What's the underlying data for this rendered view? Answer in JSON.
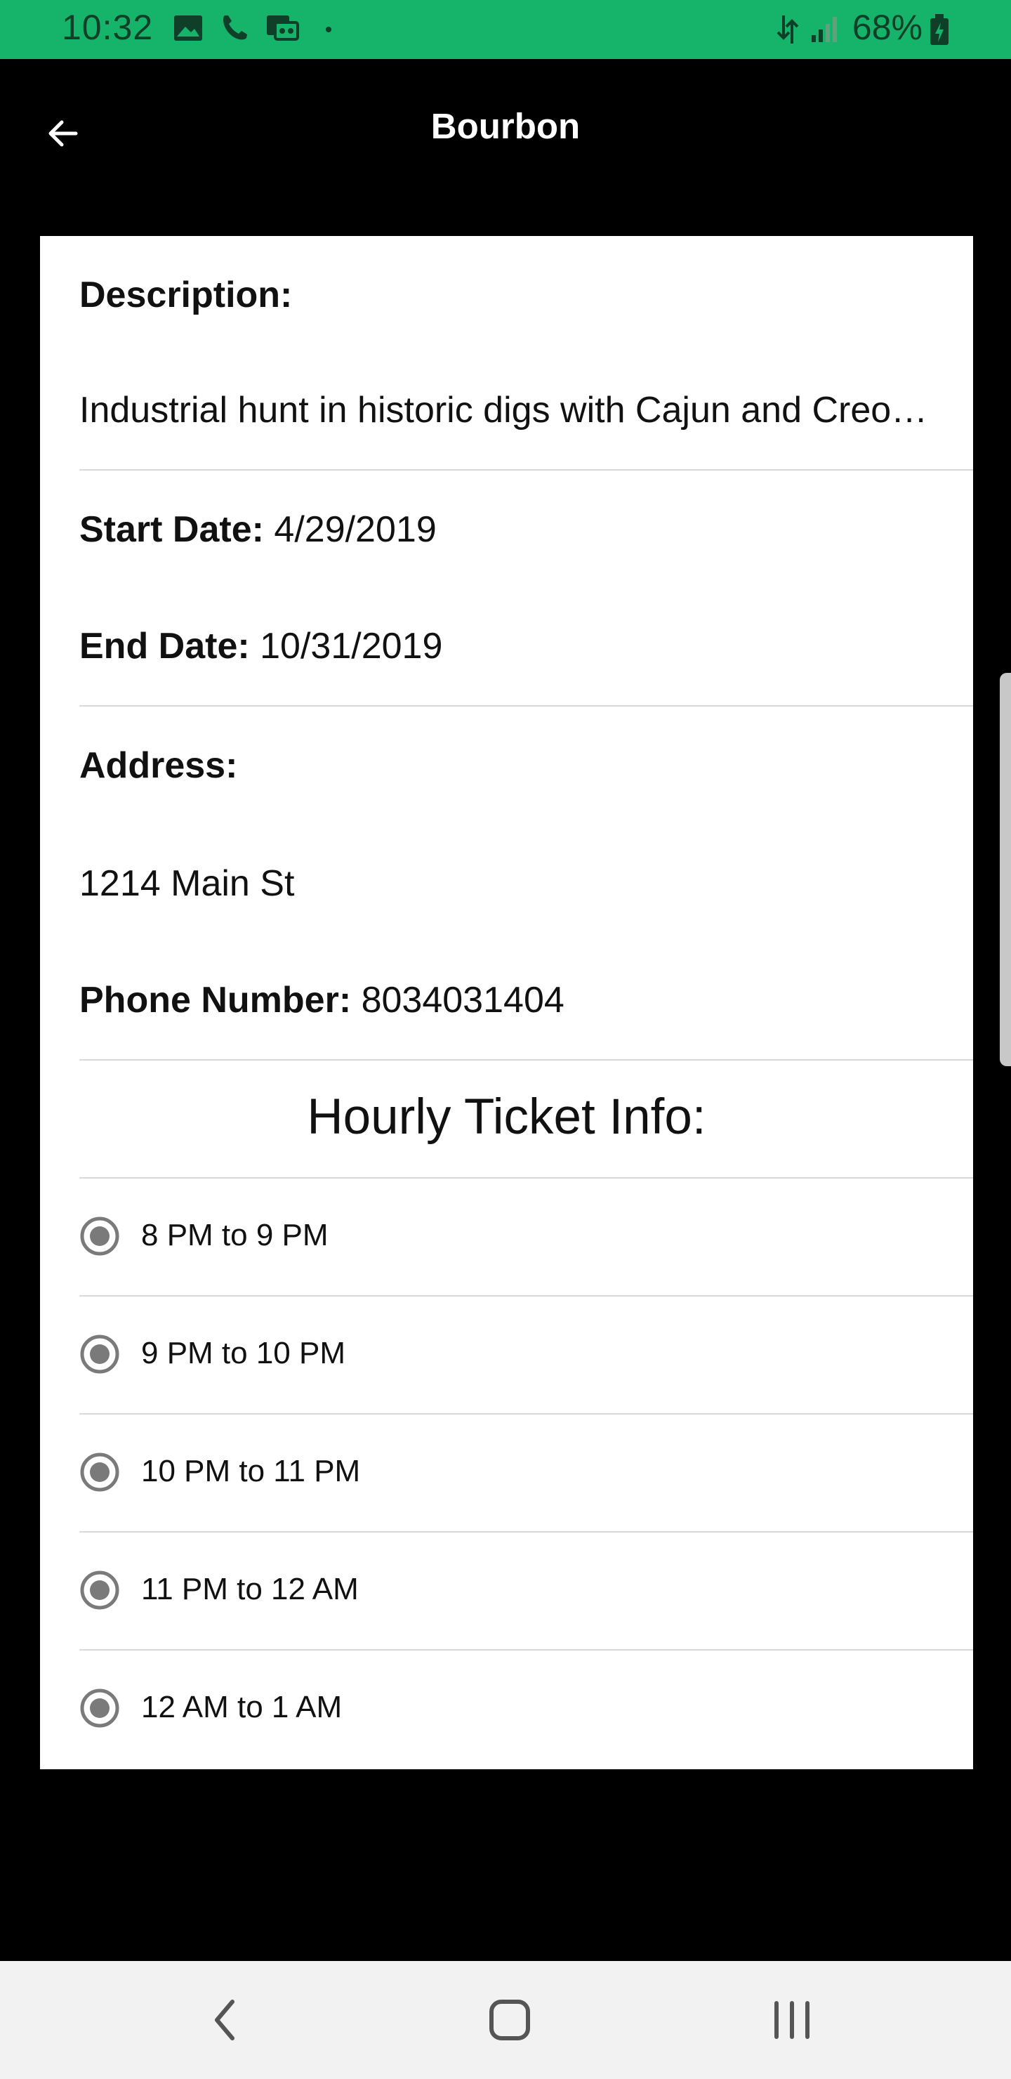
{
  "status_bar": {
    "time": "10:32",
    "battery": "68%",
    "left_icons": [
      "image-icon",
      "phone-icon",
      "voicemail-icon",
      "dot-icon"
    ],
    "right_icons": [
      "data-transfer-icon",
      "signal-icon",
      "battery-icon"
    ]
  },
  "app_bar": {
    "title": "Bourbon",
    "back_icon": "arrow-left-icon"
  },
  "details": {
    "description_label": "Description:",
    "description_value": "Industrial hunt in historic digs with Cajun and Creole dishes",
    "start_label": "Start Date:",
    "start_value": "4/29/2019",
    "end_label": "End Date:",
    "end_value": "10/31/2019",
    "address_label": "Address:",
    "address_value": "1214 Main St",
    "phone_label": "Phone Number:",
    "phone_value": "8034031404"
  },
  "tickets": {
    "title": "Hourly Ticket Info:",
    "slots": [
      "8 PM to 9 PM",
      "9 PM to 10 PM",
      "10 PM to 11 PM",
      "11 PM to 12 AM",
      "12 AM to 1 AM"
    ]
  },
  "colors": {
    "status_bar": "#16b36a",
    "app_bar": "#000000",
    "card": "#ffffff",
    "radio": "#7a7a7a"
  }
}
